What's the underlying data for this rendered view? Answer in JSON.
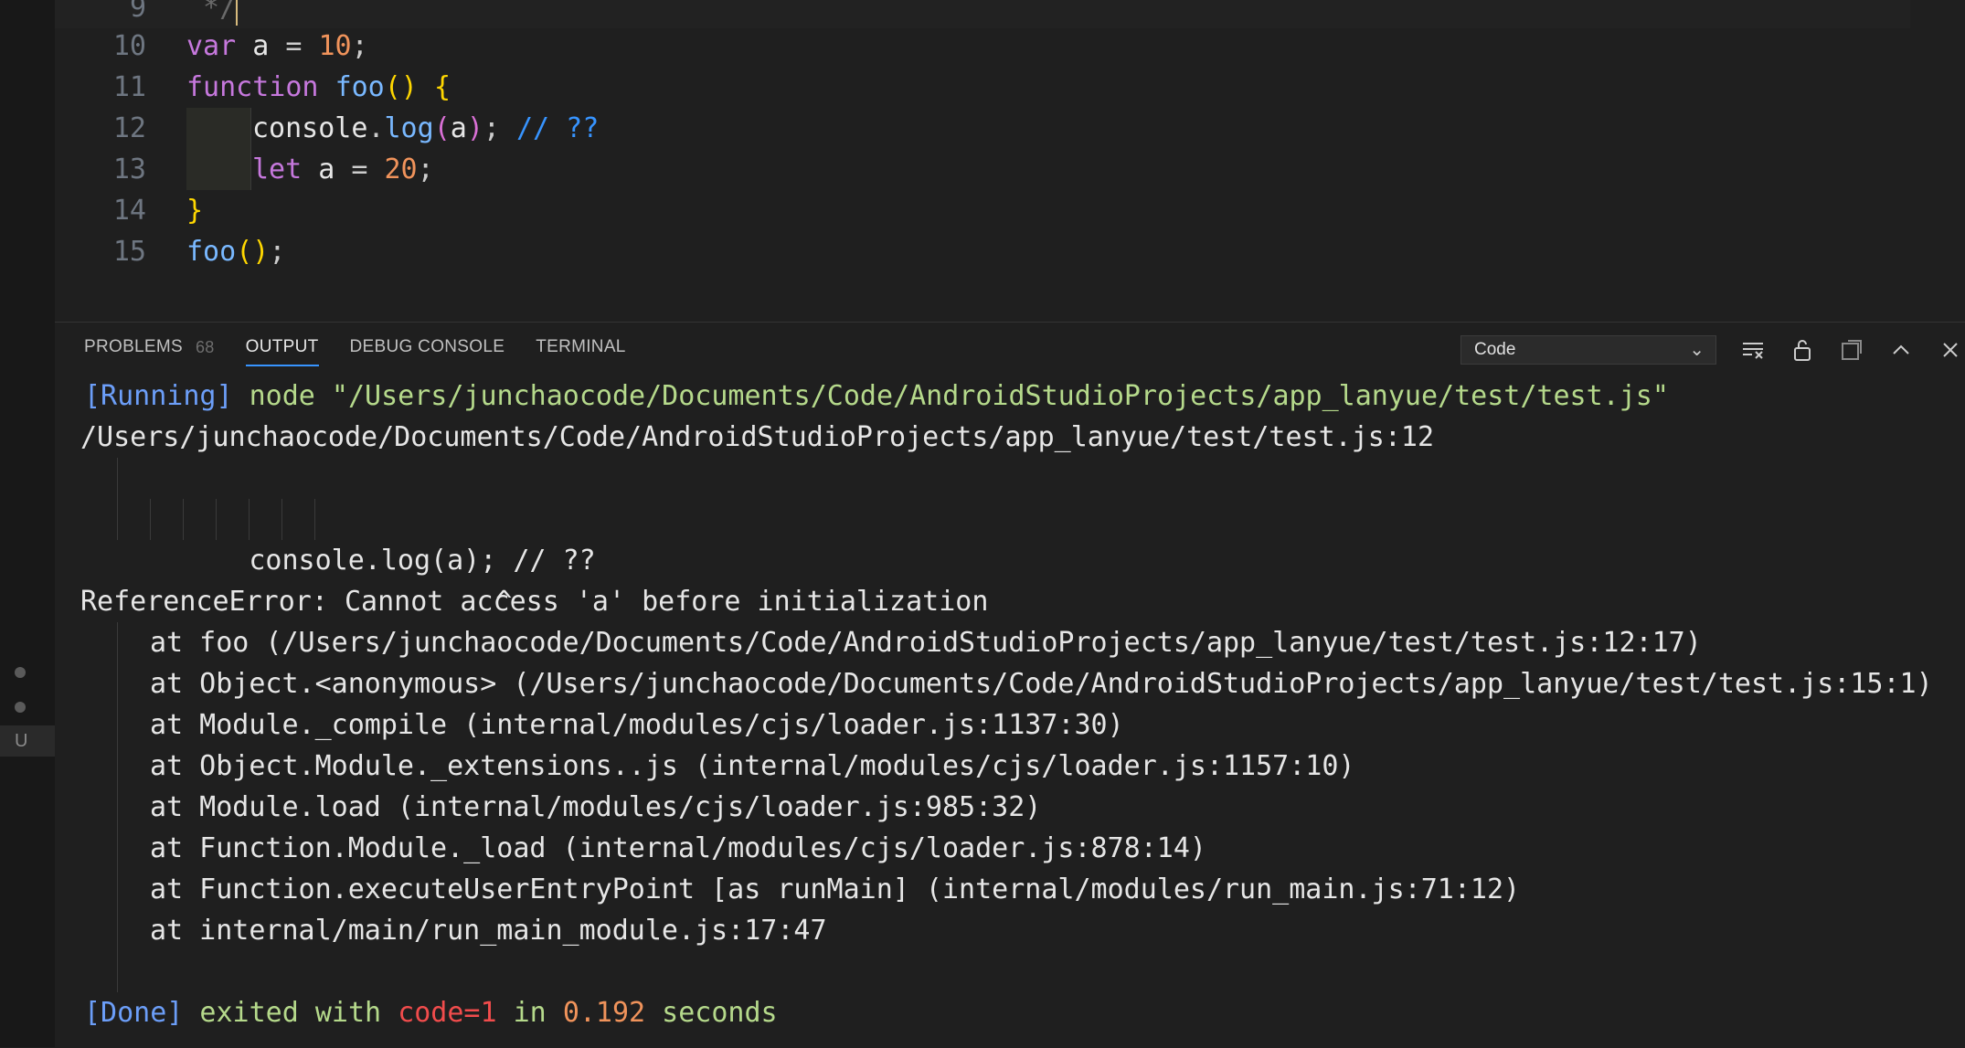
{
  "editor": {
    "lines": [
      {
        "num": "9",
        "text": " */"
      },
      {
        "num": "10",
        "kw": "var",
        "ident": " a ",
        "op": "= ",
        "num_lit": "10",
        "end": ";"
      },
      {
        "num": "11",
        "kw": "function",
        "fn": "foo",
        "parens": "()",
        "space": " ",
        "brace": "{"
      },
      {
        "num": "12",
        "obj": "console",
        "dot": ".",
        "method": "log",
        "p1": "(",
        "arg": "a",
        "p2": ")",
        "semi": "; ",
        "comment": "// ??"
      },
      {
        "num": "13",
        "kw": "let",
        "ident": " a ",
        "op": "= ",
        "num_lit": "20",
        "end": ";"
      },
      {
        "num": "14",
        "brace": "}"
      },
      {
        "num": "15",
        "fn": "foo",
        "parens": "()",
        "end": ";"
      }
    ]
  },
  "panel": {
    "tabs": [
      {
        "label": "PROBLEMS",
        "count": "68"
      },
      {
        "label": "OUTPUT"
      },
      {
        "label": "DEBUG CONSOLE"
      },
      {
        "label": "TERMINAL"
      }
    ],
    "channel_select": "Code",
    "output": {
      "running_tag": "[Running]",
      "running_cmd": " node \"/Users/junchaocode/Documents/Code/AndroidStudioProjects/app_lanyue/test/test.js\"",
      "file_ref": "/Users/junchaocode/Documents/Code/AndroidStudioProjects/app_lanyue/test/test.js:12",
      "src_line": "console.log(a); // ??",
      "caret": "^",
      "error": "ReferenceError: Cannot access 'a' before initialization",
      "stack": [
        "at foo (/Users/junchaocode/Documents/Code/AndroidStudioProjects/app_lanyue/test/test.js:12:17)",
        "at Object.<anonymous> (/Users/junchaocode/Documents/Code/AndroidStudioProjects/app_lanyue/test/test.js:15:1)",
        "at Module._compile (internal/modules/cjs/loader.js:1137:30)",
        "at Object.Module._extensions..js (internal/modules/cjs/loader.js:1157:10)",
        "at Module.load (internal/modules/cjs/loader.js:985:32)",
        "at Function.Module._load (internal/modules/cjs/loader.js:878:14)",
        "at Function.executeUserEntryPoint [as runMain] (internal/modules/run_main.js:71:12)",
        "at internal/main/run_main_module.js:17:47"
      ],
      "done_tag": "[Done]",
      "done_exited": " exited with ",
      "done_code": "code=1",
      "done_in": " in ",
      "done_time": "0.192",
      "done_seconds": " seconds"
    }
  },
  "activity": {
    "badge": "U"
  },
  "icons": [
    "clear-output-icon",
    "lock-icon",
    "open-editor-icon",
    "maximize-panel-icon",
    "close-panel-icon"
  ]
}
